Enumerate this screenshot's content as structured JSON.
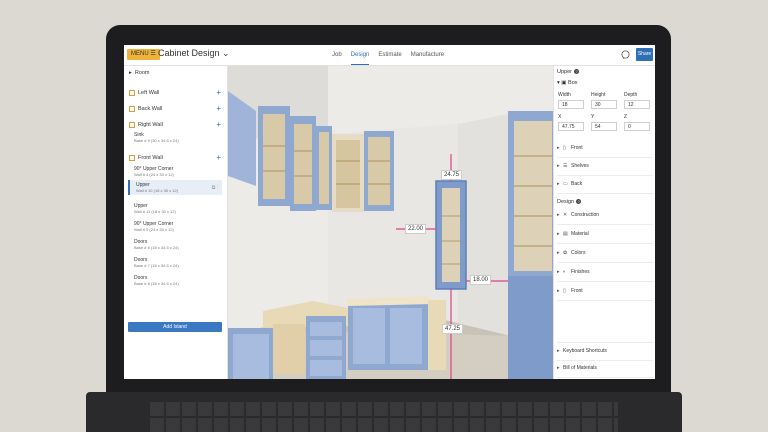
{
  "header": {
    "menu_label": "MENU ☰",
    "app_title": "Cabinet Design ⌄",
    "tabs": [
      {
        "label": "Job",
        "active": false
      },
      {
        "label": "Design",
        "active": true
      },
      {
        "label": "Estimate",
        "active": false
      },
      {
        "label": "Manufacture",
        "active": false
      }
    ],
    "share_label": "Share"
  },
  "left_panel": {
    "room_label": "Room",
    "sections": [
      {
        "label": "Left Wall"
      },
      {
        "label": "Back Wall"
      },
      {
        "label": "Right Wall"
      },
      {
        "label": "Front Wall"
      }
    ],
    "right_wall_items": [
      {
        "title": "Sink",
        "subtitle": "Base # 9 (30 x 34.5 x 24)"
      }
    ],
    "front_wall_items": [
      {
        "title": "90° Upper Corner",
        "subtitle": "Wall # 4 (24 x 30 x 12)"
      },
      {
        "title": "Upper",
        "subtitle": "Wall # 10 (18 x 30 x 12)",
        "selected": true
      },
      {
        "title": "Upper",
        "subtitle": "Wall # 11 (18 x 30 x 12)"
      },
      {
        "title": "90° Upper Corner",
        "subtitle": "Wall # 5 (24 x 30 x 12)"
      },
      {
        "title": "Doors",
        "subtitle": "Base # 6 (18 x 34.5 x 24)"
      },
      {
        "title": "Doors",
        "subtitle": "Base # 7 (18 x 34.5 x 24)"
      },
      {
        "title": "Doors",
        "subtitle": "Base # 8 (18 x 34.5 x 24)"
      }
    ],
    "add_island_label": "Add Island"
  },
  "viewport": {
    "dimensions": {
      "top": "24.75",
      "left": "22.00",
      "right": "18.00",
      "bottom": "47.25"
    }
  },
  "right_panel": {
    "title": "Upper",
    "box_label": "Box",
    "fields": {
      "width": {
        "label": "Width",
        "value": "18"
      },
      "height": {
        "label": "Height",
        "value": "30"
      },
      "depth": {
        "label": "Depth",
        "value": "12"
      },
      "x": {
        "label": "X",
        "value": "47.75"
      },
      "y": {
        "label": "Y",
        "value": "54"
      },
      "z": {
        "label": "Z",
        "value": "0"
      }
    },
    "box_rows": [
      {
        "label": "Front",
        "icon": "front-icon"
      },
      {
        "label": "Shelves",
        "icon": "shelves-icon"
      },
      {
        "label": "Back",
        "icon": "back-icon"
      }
    ],
    "design_label": "Design",
    "design_rows": [
      {
        "label": "Construction",
        "icon": "construction-icon"
      },
      {
        "label": "Material",
        "icon": "material-icon"
      },
      {
        "label": "Colors",
        "icon": "colors-icon"
      },
      {
        "label": "Finishes",
        "icon": "finishes-icon"
      },
      {
        "label": "Front",
        "icon": "front-icon"
      }
    ],
    "footer_rows": [
      {
        "label": "Keyboard Shortcuts"
      },
      {
        "label": "Bill of Materials"
      }
    ]
  },
  "colors": {
    "accent": "#2f6fb3",
    "menu": "#f0b33a",
    "cabinet_blue": "#8fa8d0",
    "dimension_pink": "#e0408a"
  }
}
